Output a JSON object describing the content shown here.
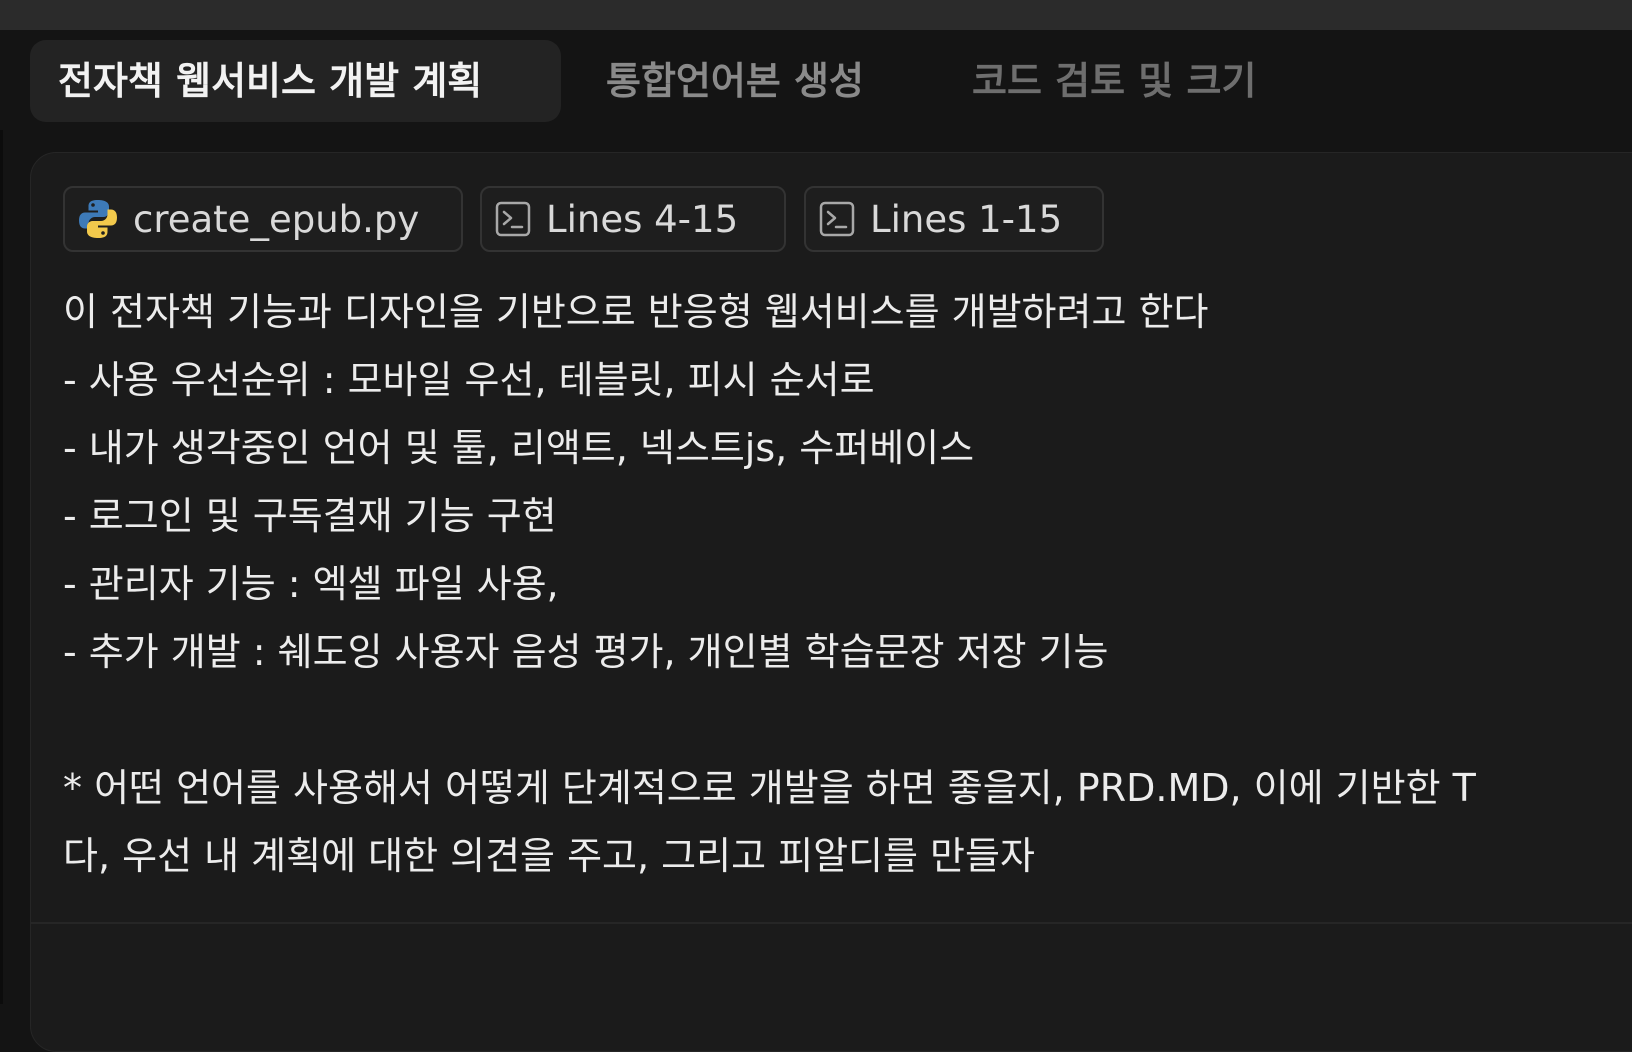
{
  "tabs": [
    {
      "label": "전자책 웹서비스 개발 계획",
      "active": true
    },
    {
      "label": "통합언어본 생성",
      "active": false
    },
    {
      "label": "코드 검토 및 크기",
      "active": false
    }
  ],
  "context_chips": [
    {
      "icon": "python-file-icon",
      "label": "create_epub.py"
    },
    {
      "icon": "terminal-icon",
      "label": "Lines 4-15"
    },
    {
      "icon": "terminal-icon",
      "label": "Lines 1-15"
    }
  ],
  "message": {
    "lines": [
      "이 전자책 기능과 디자인을 기반으로 반응형 웹서비스를 개발하려고 한다",
      "- 사용 우선순위 : 모바일 우선, 테블릿, 피시 순서로",
      "- 내가 생각중인 언어 및 툴, 리액트, 넥스트js, 수퍼베이스",
      "- 로그인 및 구독결재 기능 구현",
      "- 관리자 기능 : 엑셀 파일 사용,",
      "- 추가 개발 : 쉐도잉 사용자 음성 평가, 개인별 학습문장 저장 기능",
      "",
      "* 어떤 언어를 사용해서 어떻게 단계적으로 개발을 하면 좋을지, PRD.MD, 이에 기반한 T",
      "다, 우선 내 계획에 대한 의견을 주고, 그리고 피알디를 만들자"
    ]
  },
  "colors": {
    "background": "#141414",
    "panel": "#1b1b1b",
    "active_tab": "#232323",
    "text": "#ececec",
    "muted_text": "#8a8a8a"
  }
}
